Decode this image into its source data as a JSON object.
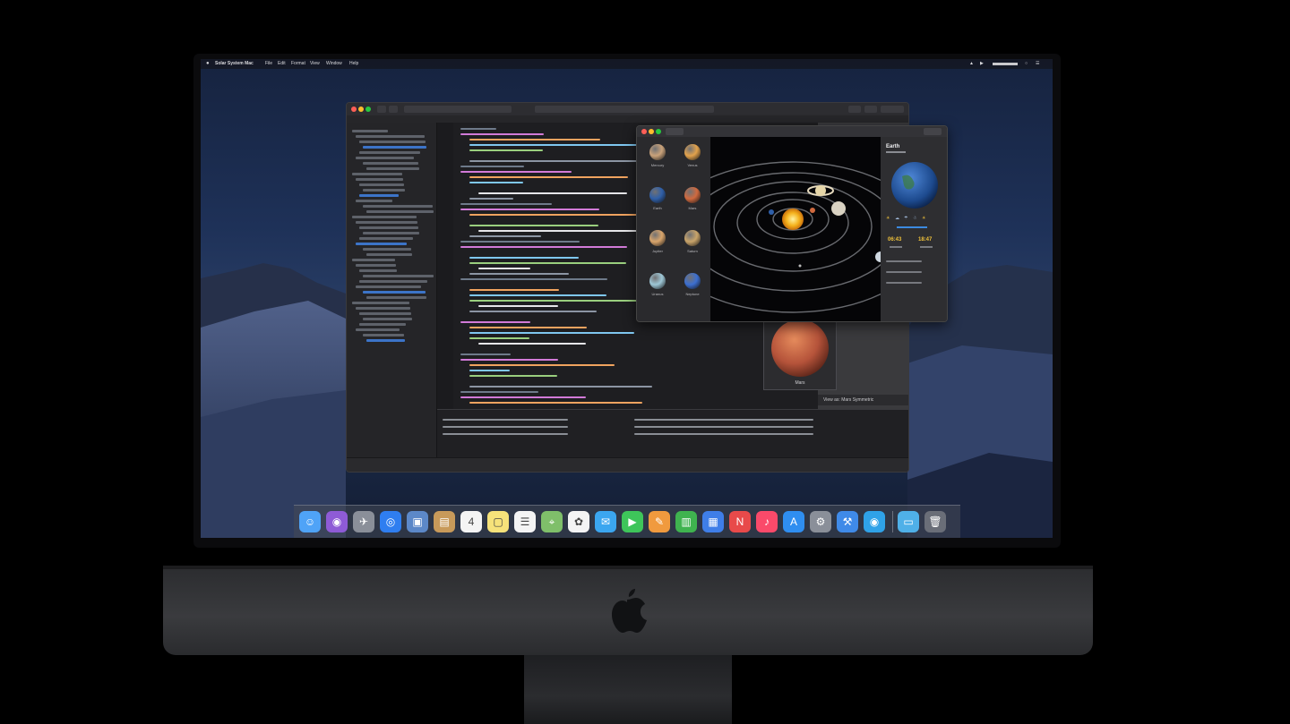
{
  "menubar": {
    "app_name": "Solar System Mac",
    "items": [
      "File",
      "Edit",
      "Format",
      "View",
      "Window",
      "Help"
    ]
  },
  "planets": [
    {
      "name": "Mercury",
      "color": "#c9a27a"
    },
    {
      "name": "Venus",
      "color": "#e2a24c"
    },
    {
      "name": "Earth",
      "color": "#2f5fa8"
    },
    {
      "name": "Mars",
      "color": "#d06a3f"
    },
    {
      "name": "Jupiter",
      "color": "#d9a56c"
    },
    {
      "name": "Saturn",
      "color": "#c9a46a"
    },
    {
      "name": "Uranus",
      "color": "#9ec7d6"
    },
    {
      "name": "Neptune",
      "color": "#3c6fd1"
    }
  ],
  "info_panel": {
    "title": "Earth",
    "time_left": "06:43",
    "time_right": "18:47"
  },
  "preview": {
    "caption": "View as: Mars Symmetric",
    "planet_label": "Mars"
  },
  "dock": {
    "icons": [
      "finder-icon",
      "siri-icon",
      "launchpad-icon",
      "safari-icon",
      "photo-icon",
      "notes-icon",
      "calendar-icon",
      "stickies-icon",
      "reminders-icon",
      "maps-icon",
      "photos-icon",
      "messages-icon",
      "facetime-icon",
      "pages-icon",
      "numbers-icon",
      "keynote-icon",
      "news-icon",
      "music-icon",
      "app-store-icon",
      "system-preferences-icon",
      "xcode-icon",
      "simulator-icon",
      "folder-icon",
      "trash-icon"
    ]
  },
  "colors": {
    "accent_yellow": "#f0c23a",
    "window_bg": "#1f1f22"
  }
}
